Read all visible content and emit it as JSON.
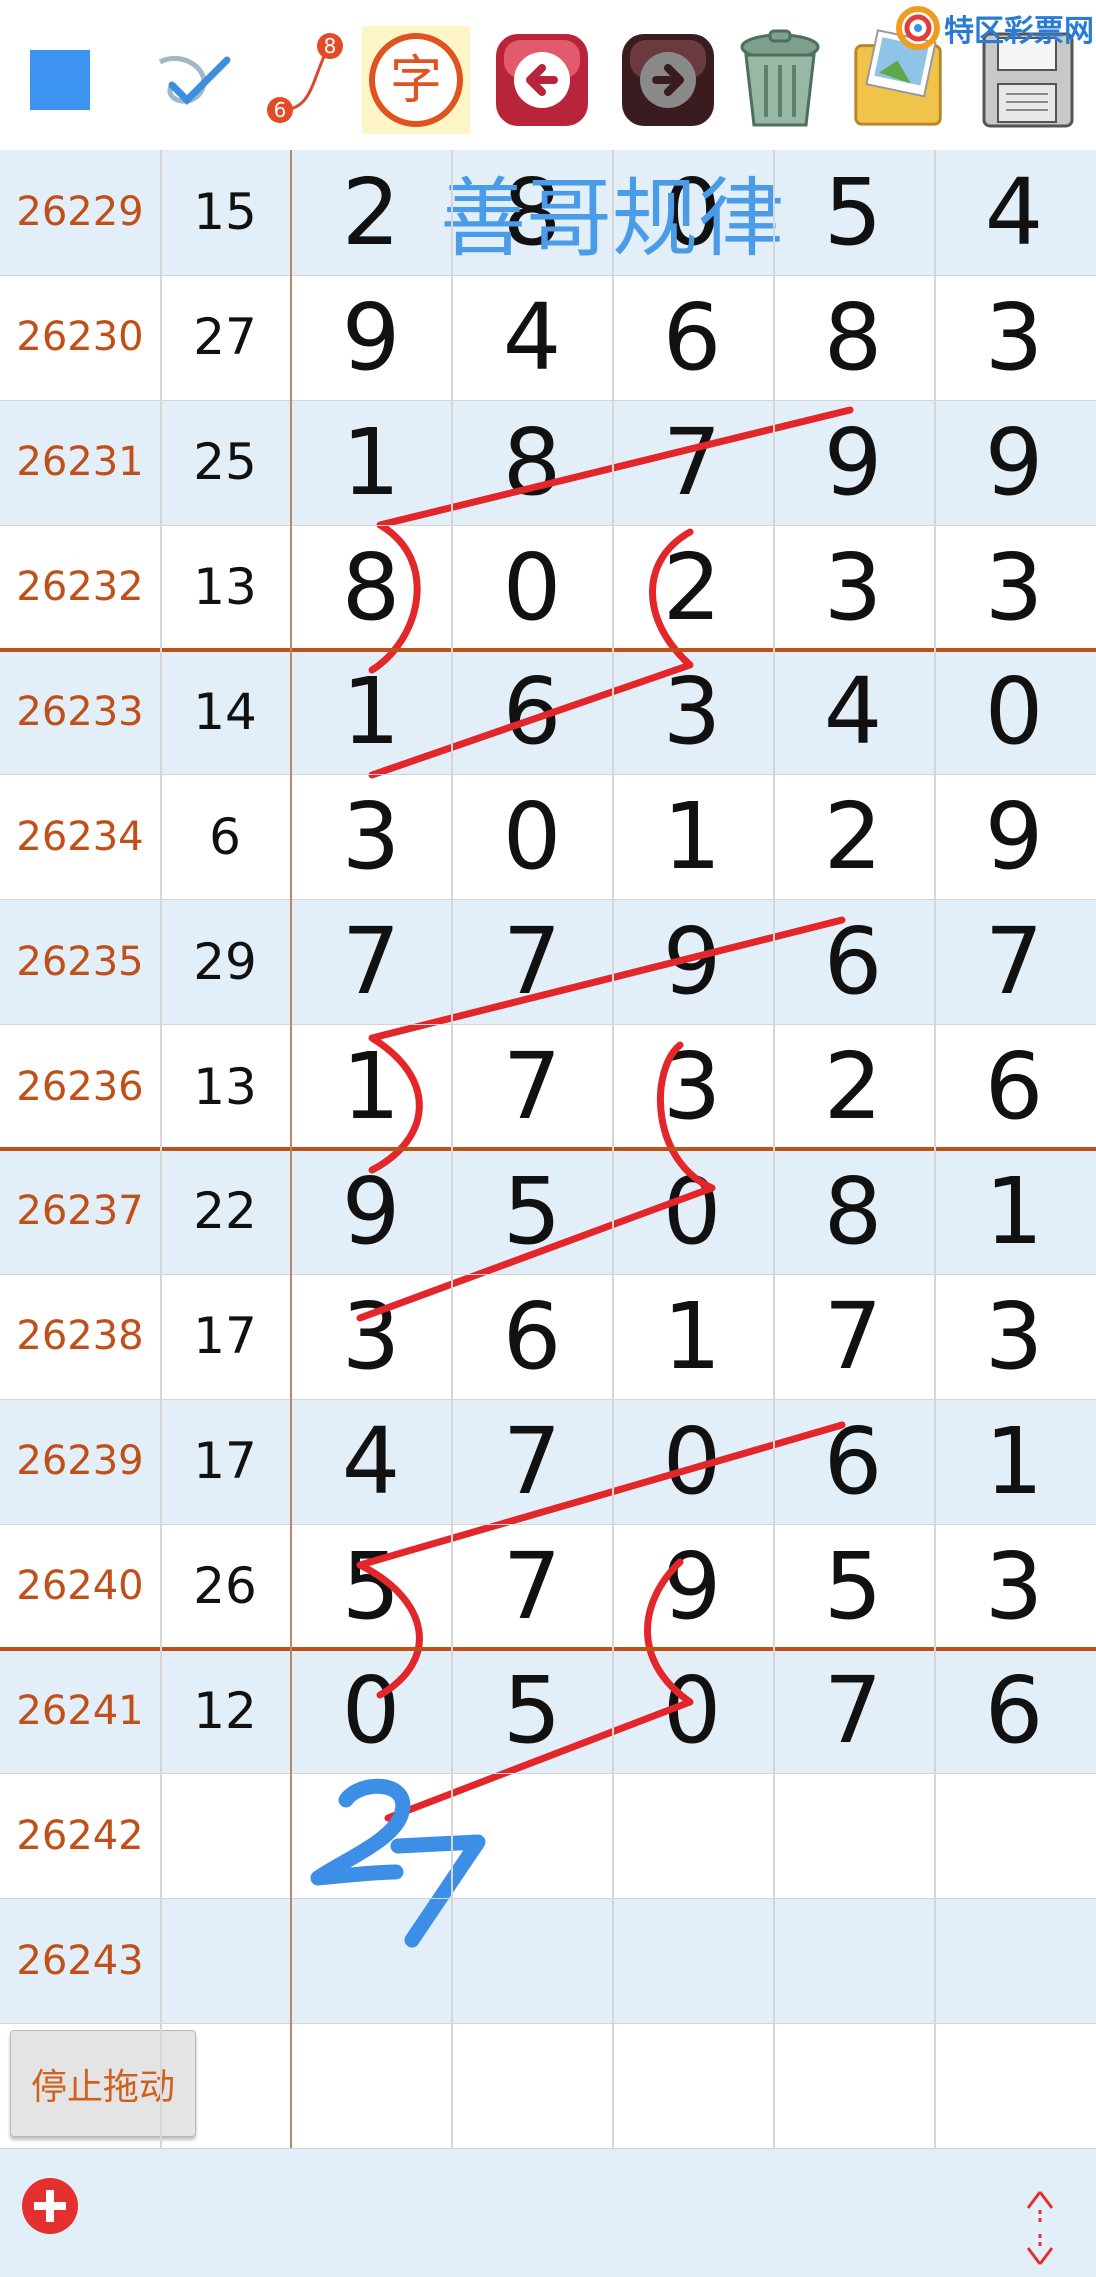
{
  "toolbar": {
    "tools": [
      {
        "name": "square-tool-icon"
      },
      {
        "name": "pen-tool-icon"
      },
      {
        "name": "line-tool-icon",
        "start_label": "6",
        "end_label": "8"
      },
      {
        "name": "text-tool-icon",
        "label": "字"
      },
      {
        "name": "undo-arrow-icon"
      },
      {
        "name": "redo-arrow-icon"
      },
      {
        "name": "trash-can-icon"
      },
      {
        "name": "photo-album-icon"
      },
      {
        "name": "save-floppy-icon"
      }
    ],
    "logo_text": "特区彩票网"
  },
  "title_annotation": "善哥规律",
  "table": {
    "rows": [
      {
        "issue": "26229",
        "sum": "15",
        "digits": [
          "2",
          "8",
          "0",
          "5",
          "4"
        ]
      },
      {
        "issue": "26230",
        "sum": "27",
        "digits": [
          "9",
          "4",
          "6",
          "8",
          "3"
        ]
      },
      {
        "issue": "26231",
        "sum": "25",
        "digits": [
          "1",
          "8",
          "7",
          "9",
          "9"
        ]
      },
      {
        "issue": "26232",
        "sum": "13",
        "digits": [
          "8",
          "0",
          "2",
          "3",
          "3"
        ]
      },
      {
        "issue": "26233",
        "sum": "14",
        "digits": [
          "1",
          "6",
          "3",
          "4",
          "0"
        ]
      },
      {
        "issue": "26234",
        "sum": "6",
        "digits": [
          "3",
          "0",
          "1",
          "2",
          "9"
        ]
      },
      {
        "issue": "26235",
        "sum": "29",
        "digits": [
          "7",
          "7",
          "9",
          "6",
          "7"
        ]
      },
      {
        "issue": "26236",
        "sum": "13",
        "digits": [
          "1",
          "7",
          "3",
          "2",
          "6"
        ]
      },
      {
        "issue": "26237",
        "sum": "22",
        "digits": [
          "9",
          "5",
          "0",
          "8",
          "1"
        ]
      },
      {
        "issue": "26238",
        "sum": "17",
        "digits": [
          "3",
          "6",
          "1",
          "7",
          "3"
        ]
      },
      {
        "issue": "26239",
        "sum": "17",
        "digits": [
          "4",
          "7",
          "0",
          "6",
          "1"
        ]
      },
      {
        "issue": "26240",
        "sum": "26",
        "digits": [
          "5",
          "7",
          "9",
          "5",
          "3"
        ]
      },
      {
        "issue": "26241",
        "sum": "12",
        "digits": [
          "0",
          "5",
          "0",
          "7",
          "6"
        ]
      },
      {
        "issue": "26242",
        "sum": "",
        "digits": [
          "",
          "",
          "",
          "",
          ""
        ]
      },
      {
        "issue": "26243",
        "sum": "",
        "digits": [
          "",
          "",
          "",
          "",
          ""
        ]
      },
      {
        "issue": "",
        "sum": "",
        "digits": [
          "",
          "",
          "",
          "",
          ""
        ]
      }
    ]
  },
  "handwritten_prediction": "27",
  "stop_drag_button": "停止拖动",
  "footer": {
    "add_icon": "plus-circle-icon",
    "scroll_icon": "expand-arrows-icon"
  },
  "colors": {
    "issue_text": "#c0501a",
    "row_alt": "#e3eff8",
    "annotation_red": "#e3262a",
    "annotation_blue": "#3d8ee6",
    "title_blue": "#4a9be8"
  }
}
